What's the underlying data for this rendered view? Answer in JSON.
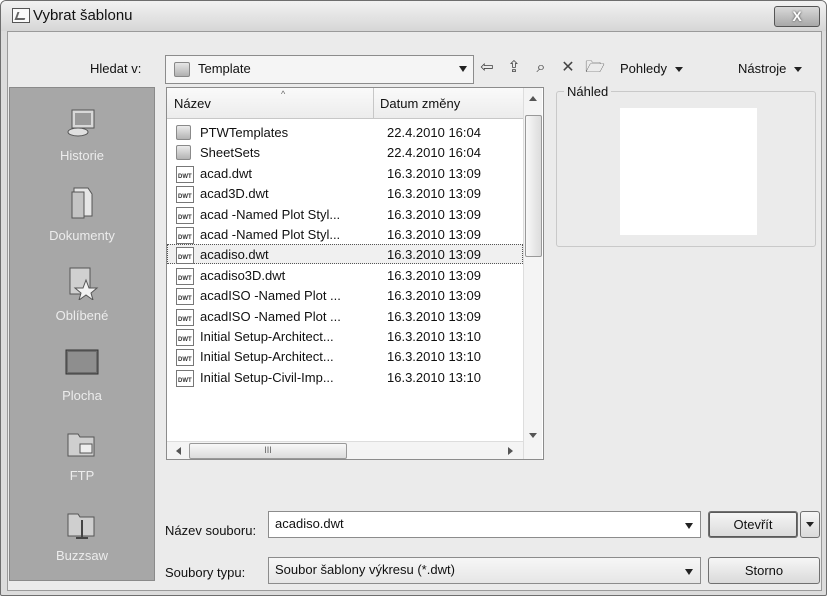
{
  "window": {
    "title": "Vybrat šablonu",
    "close_label": "X"
  },
  "lookin": {
    "label": "Hledat v:",
    "value": "Template"
  },
  "toolbar": {
    "back_glyph": "⇦",
    "up_glyph": "⇪",
    "search_glyph": "⌕",
    "delete_glyph": "✕",
    "newfolder_glyph": "🗁",
    "views_label": "Pohledy",
    "tools_label": "Nástroje"
  },
  "places": [
    {
      "label": "Historie",
      "icon": "history-icon"
    },
    {
      "label": "Dokumenty",
      "icon": "documents-icon"
    },
    {
      "label": "Oblíbené",
      "icon": "favorites-icon"
    },
    {
      "label": "Plocha",
      "icon": "desktop-icon"
    },
    {
      "label": "FTP",
      "icon": "ftp-icon"
    },
    {
      "label": "Buzzsaw",
      "icon": "buzzsaw-icon"
    }
  ],
  "filelist": {
    "col_name": "Název",
    "col_date": "Datum změny",
    "icon_text": "DWT",
    "scroll_grip": "III",
    "rows": [
      {
        "name": "PTWTemplates",
        "date": "22.4.2010 16:04",
        "type": "folder"
      },
      {
        "name": "SheetSets",
        "date": "22.4.2010 16:04",
        "type": "folder"
      },
      {
        "name": "acad.dwt",
        "date": "16.3.2010 13:09",
        "type": "dwt"
      },
      {
        "name": "acad3D.dwt",
        "date": "16.3.2010 13:09",
        "type": "dwt"
      },
      {
        "name": "acad -Named Plot Styl...",
        "date": "16.3.2010 13:09",
        "type": "dwt"
      },
      {
        "name": "acad -Named Plot Styl...",
        "date": "16.3.2010 13:09",
        "type": "dwt"
      },
      {
        "name": "acadiso.dwt",
        "date": "16.3.2010 13:09",
        "type": "dwt",
        "selected": true
      },
      {
        "name": "acadiso3D.dwt",
        "date": "16.3.2010 13:09",
        "type": "dwt"
      },
      {
        "name": "acadISO -Named Plot ...",
        "date": "16.3.2010 13:09",
        "type": "dwt"
      },
      {
        "name": "acadISO -Named Plot ...",
        "date": "16.3.2010 13:09",
        "type": "dwt"
      },
      {
        "name": "Initial Setup-Architect...",
        "date": "16.3.2010 13:10",
        "type": "dwt"
      },
      {
        "name": "Initial Setup-Architect...",
        "date": "16.3.2010 13:10",
        "type": "dwt"
      },
      {
        "name": "Initial Setup-Civil-Imp...",
        "date": "16.3.2010 13:10",
        "type": "dwt"
      }
    ]
  },
  "preview": {
    "label": "Náhled"
  },
  "filename": {
    "label": "Název souboru:",
    "value": "acadiso.dwt",
    "open_label": "Otevřít"
  },
  "filetype": {
    "label": "Soubory typu:",
    "value": "Soubor šablony výkresu (*.dwt)",
    "cancel_label": "Storno"
  }
}
